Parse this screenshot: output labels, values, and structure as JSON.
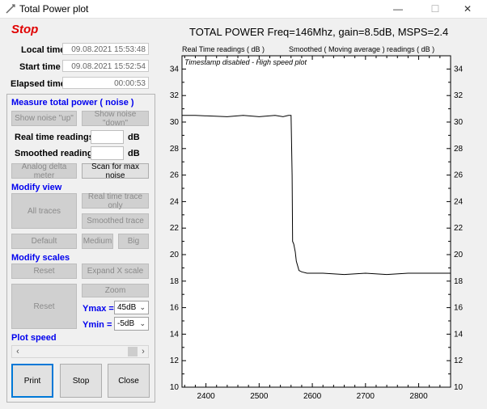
{
  "window": {
    "title": "Total Power plot",
    "min": "—",
    "max": "☐",
    "close": "✕"
  },
  "status": {
    "stop_label": "Stop"
  },
  "times": {
    "local_label": "Local time",
    "local_value": "09.08.2021 15:53:48",
    "start_label": "Start time",
    "start_value": "09.08.2021 15:52:54",
    "elapsed_label": "Elapsed time",
    "elapsed_value": "00:00:53"
  },
  "measure": {
    "title": "Measure total power ( noise )",
    "noise_up": "Show noise \"up\"",
    "noise_down": "Show noise \"down\"",
    "realtime_label": "Real time readings",
    "smoothed_label": "Smoothed readings",
    "db": "dB",
    "analog_delta": "Analog delta meter",
    "scan_max": "Scan for max noise"
  },
  "view": {
    "title": "Modify view",
    "all_traces": "All traces",
    "realtime_only": "Real time trace only",
    "smoothed_trace": "Smoothed  trace",
    "default": "Default",
    "medium": "Medium",
    "big": "Big"
  },
  "scales": {
    "title": "Modify scales",
    "reset1": "Reset",
    "expand_x": "Expand  X scale",
    "zoom": "Zoom",
    "reset2": "Reset",
    "ymax_label": "Ymax =",
    "ymax_value": "45dB",
    "ymin_label": "Ymin =",
    "ymin_value": "-5dB"
  },
  "speed": {
    "title": "Plot speed"
  },
  "actions": {
    "print": "Print",
    "stop": "Stop",
    "close": "Close"
  },
  "plot": {
    "title": "TOTAL POWER  Freq=146Mhz,  gain=8.5dB, MSPS=2.4",
    "left_axis_label": "Real Time readings ( dB )",
    "right_axis_label": "Smoothed ( Moving average ) readings ( dB )",
    "annotation": "Timestamp disabled  - High speed plot"
  },
  "chart_data": {
    "type": "line",
    "xlim": [
      2355,
      2860
    ],
    "ylim": [
      10,
      35
    ],
    "x_ticks": [
      2400,
      2500,
      2600,
      2700,
      2800
    ],
    "y_ticks": [
      10,
      12,
      14,
      16,
      18,
      20,
      22,
      24,
      26,
      28,
      30,
      32,
      34
    ],
    "grid": false,
    "series": [
      {
        "x": [
          2355,
          2380,
          2440,
          2470,
          2500,
          2530,
          2545,
          2555,
          2560,
          2562,
          2563,
          2565,
          2568,
          2570,
          2575,
          2580,
          2590,
          2620,
          2660,
          2700,
          2740,
          2780,
          2820,
          2860
        ],
        "y": [
          30.5,
          30.5,
          30.4,
          30.5,
          30.4,
          30.5,
          30.4,
          30.5,
          30.5,
          26.0,
          21.0,
          20.8,
          20.2,
          19.5,
          18.8,
          18.7,
          18.6,
          18.6,
          18.5,
          18.6,
          18.5,
          18.6,
          18.6,
          18.6
        ],
        "color": "#000000"
      }
    ]
  }
}
